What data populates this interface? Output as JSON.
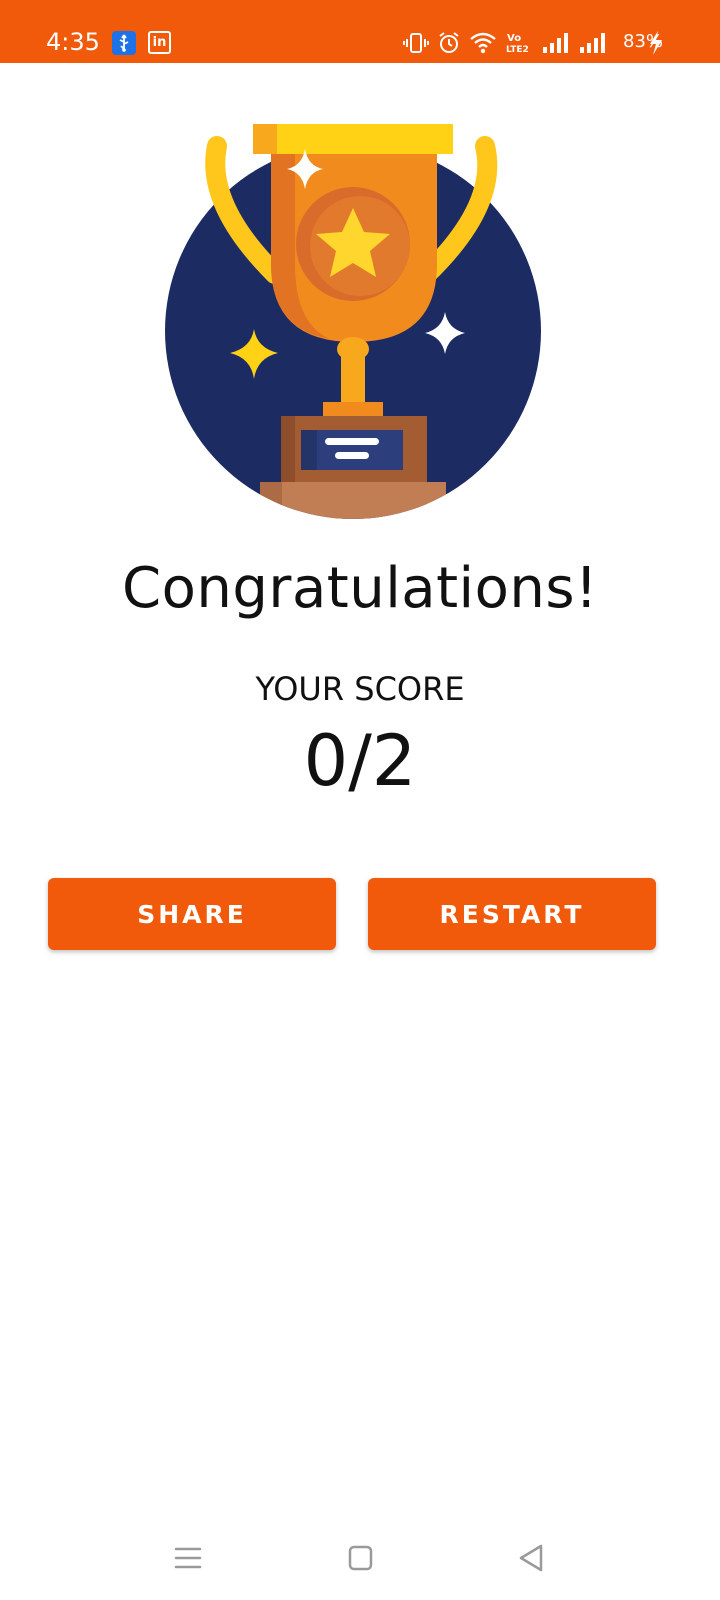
{
  "status_bar": {
    "time": "4:35",
    "battery": "83%",
    "background": "#f05a0a",
    "notification_icons": [
      "usb-icon",
      "linkedin-icon"
    ],
    "system_icons": [
      "vibrate-icon",
      "alarm-icon",
      "wifi-icon",
      "volte-icon",
      "signal-icon",
      "signal-icon",
      "charging-icon"
    ],
    "linkedin_glyph": "in",
    "volte_top": "Vo",
    "volte_bottom": "LTE2"
  },
  "result": {
    "title": "Congratulations!",
    "score_label": "YOUR SCORE",
    "score": "0/2",
    "illustration": "trophy"
  },
  "actions": {
    "share_label": "SHARE",
    "restart_label": "RESTART",
    "button_color": "#f05a0a"
  },
  "nav_bar": {
    "icons": [
      "menu-icon",
      "home-icon",
      "back-icon"
    ]
  }
}
